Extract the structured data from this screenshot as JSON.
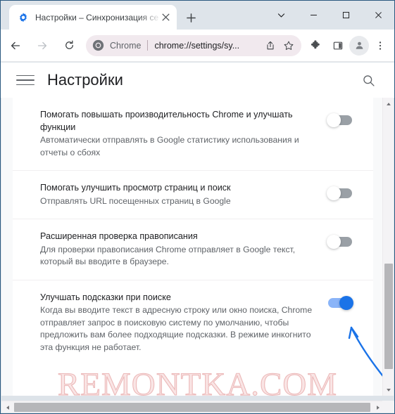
{
  "window": {
    "controls": {
      "tab_search": "tab-search-chevron",
      "minimize": "minimize",
      "maximize": "maximize",
      "close": "close"
    }
  },
  "tab": {
    "title": "Настройки – Синхронизация се",
    "favicon": "settings-gear-favicon",
    "close_label": "×",
    "new_tab_label": "+"
  },
  "toolbar": {
    "back": "back-arrow",
    "forward": "forward-arrow",
    "reload": "reload-arrow",
    "omnibox": {
      "site_label": "Chrome",
      "url": "chrome://settings/sy...",
      "share_icon": "share-icon",
      "bookmark_icon": "star-icon"
    },
    "extensions_icon": "puzzle-icon",
    "side_panel_icon": "side-panel-icon",
    "profile_icon": "person-avatar-icon",
    "menu_icon": "three-dots-icon"
  },
  "settings_header": {
    "menu_icon": "hamburger-icon",
    "title": "Настройки",
    "search_icon": "search-icon"
  },
  "settings_rows": [
    {
      "title": "Помогать повышать производительность Chrome и улучшать функции",
      "subtitle": "Автоматически отправлять в Google статистику использования и отчеты о сбоях",
      "toggle": "off"
    },
    {
      "title": "Помогать улучшить просмотр страниц и поиск",
      "subtitle": "Отправлять URL посещенных страниц в Google",
      "toggle": "off"
    },
    {
      "title": "Расширенная проверка правописания",
      "subtitle": "Для проверки правописания Chrome отправляет в Google текст, который вы вводите в браузере.",
      "toggle": "off"
    },
    {
      "title": "Улучшать подсказки при поиске",
      "subtitle": "Когда вы вводите текст в адресную строку или окно поиска, Chrome отправляет запрос в поисковую систему по умолчанию, чтобы предложить вам более подходящие подсказки. В режиме инкогнито эта функция не работает.",
      "toggle": "on"
    }
  ],
  "annotation": {
    "type": "curved-arrow",
    "points_to": "Улучшать подсказки при поиске"
  },
  "watermark": {
    "text": "REMONTKA.COM"
  },
  "colors": {
    "accent": "#1a73e8",
    "toggle_on_track": "#8ab4f8",
    "toggle_off_track": "#9aa0a6",
    "annotation": "#1a73e8",
    "watermark": "#eaaaaa",
    "titlebar": "#dee4ea",
    "content_bg": "#f8f9fa"
  },
  "scrollbars": {
    "vertical": "vertical-scrollbar",
    "horizontal": "horizontal-scrollbar"
  }
}
